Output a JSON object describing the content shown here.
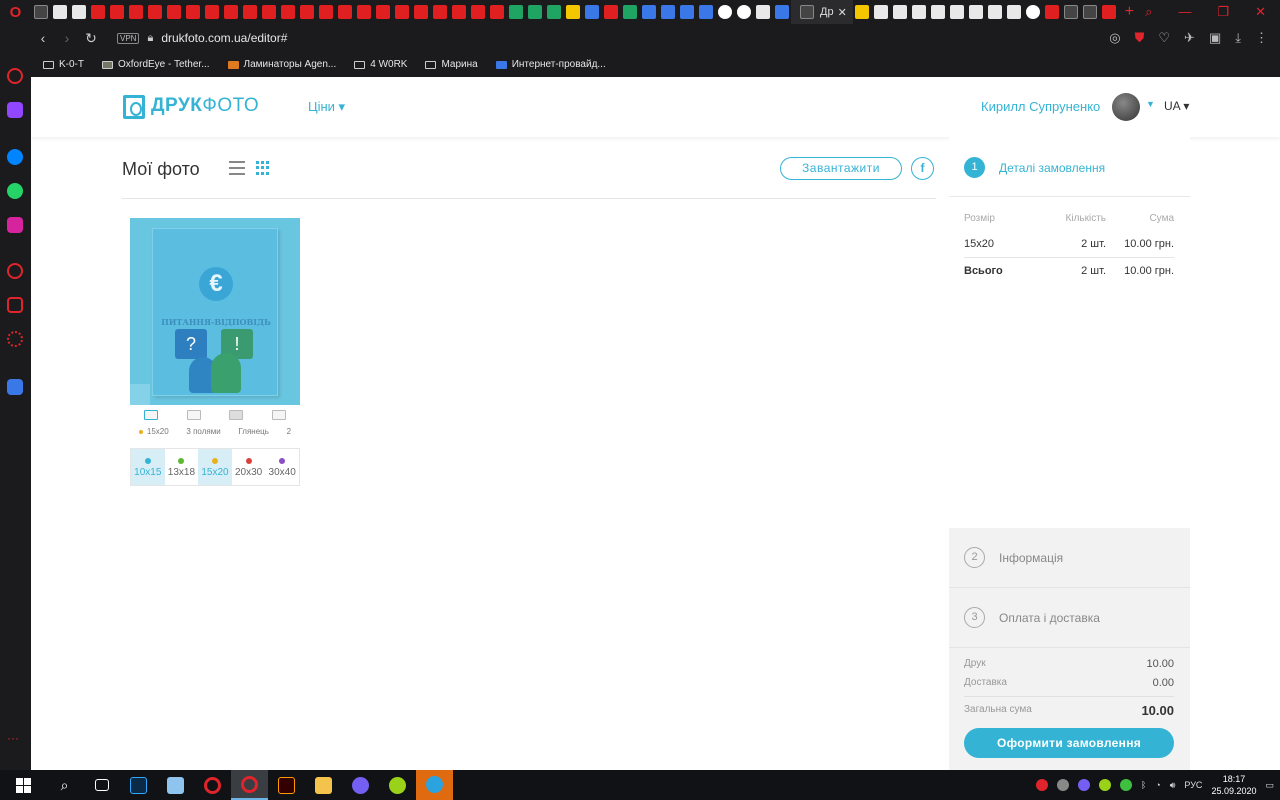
{
  "browser": {
    "active_tab_label": "Др",
    "address_vpn": "VPN",
    "url": "drukfoto.com.ua/editor#",
    "bookmarks": [
      "K-0-T",
      "OxfordEye - Tether...",
      "Ламинаторы Agen...",
      "4 W0RK",
      "Марина",
      "Интернет-провайд..."
    ]
  },
  "header": {
    "logo_bold": "ДРУК",
    "logo_light": "ФОТО",
    "prices_label": "Ціни ▾",
    "user_name": "Кирилл Супруненко",
    "lang": "UA ▾"
  },
  "gallery": {
    "title": "Мої фото",
    "upload_label": "Завантажити",
    "fb_label": "f",
    "photo": {
      "caption": "ПИТАННЯ-ВІДПОВІДЬ",
      "euro_symbol": "€",
      "q_symbol": "?",
      "e_symbol": "!"
    },
    "options": [
      "15x20",
      "3 полями",
      "Глянець",
      "2"
    ],
    "sizes": [
      {
        "label": "10x15",
        "color": "#35b3d4",
        "selected": true
      },
      {
        "label": "13x18",
        "color": "#5cb82e",
        "selected": false
      },
      {
        "label": "15x20",
        "color": "#e8b21c",
        "selected": true
      },
      {
        "label": "20x30",
        "color": "#d9413a",
        "selected": false
      },
      {
        "label": "30x40",
        "color": "#8a4fc4",
        "selected": false
      }
    ]
  },
  "order": {
    "step1": {
      "num": "1",
      "title": "Деталі замовлення"
    },
    "table": {
      "headers": [
        "Розмір",
        "Кількість",
        "Сума"
      ],
      "row": [
        "15x20",
        "2 шт.",
        "10.00 грн."
      ],
      "total": [
        "Всього",
        "2 шт.",
        "10.00 грн."
      ]
    },
    "step2": {
      "num": "2",
      "title": "Інформація"
    },
    "step3": {
      "num": "3",
      "title": "Оплата і доставка"
    },
    "summary": {
      "print_label": "Друк",
      "print_value": "10.00",
      "delivery_label": "Доставка",
      "delivery_value": "0.00",
      "total_label": "Загальна сума",
      "total_value": "10.00"
    },
    "checkout_label": "Оформити замовлення"
  },
  "taskbar": {
    "lang": "РУС",
    "time": "18:17",
    "date": "25.09.2020"
  },
  "colors": {
    "accent": "#35b3d4",
    "opera_red": "#e0242b"
  }
}
